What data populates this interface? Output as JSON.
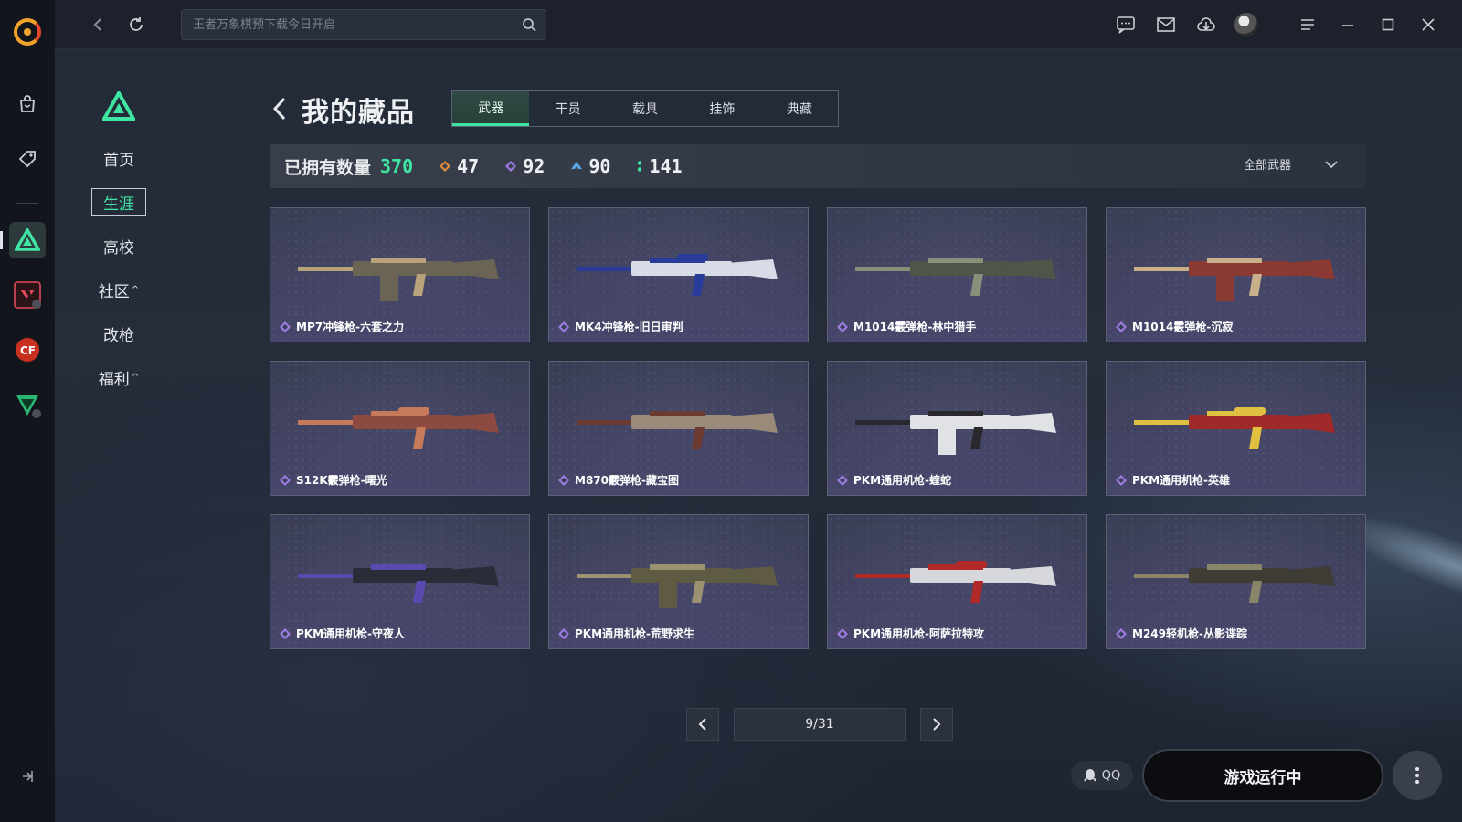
{
  "topbar": {
    "search_placeholder": "王者万象棋预下载今日开启"
  },
  "sidenav": {
    "items": [
      {
        "label": "首页",
        "caret": ""
      },
      {
        "label": "生涯",
        "caret": ""
      },
      {
        "label": "高校",
        "caret": ""
      },
      {
        "label": "社区",
        "caret": "^"
      },
      {
        "label": "改枪",
        "caret": ""
      },
      {
        "label": "福利",
        "caret": "^"
      }
    ],
    "active_index": 1
  },
  "header": {
    "title": "我的藏品",
    "tabs": [
      "武器",
      "干员",
      "载具",
      "挂饰",
      "典藏"
    ],
    "active_tab": 0
  },
  "stats": {
    "owned_label": "已拥有数量",
    "owned_count": "370",
    "rarities": [
      {
        "icon": "orange-diamond-icon",
        "color": "#e08a3c",
        "count": "47"
      },
      {
        "icon": "purple-diamond-icon",
        "color": "#9b7be0",
        "count": "92"
      },
      {
        "icon": "blue-arrow-icon",
        "color": "#5aa6e8",
        "count": "90"
      },
      {
        "icon": "green-dots-icon",
        "color": "#3fe6a3",
        "count": "141"
      }
    ],
    "filter_label": "全部武器"
  },
  "items": [
    {
      "name": "MP7冲锋枪-六套之力",
      "body": "#6b6455",
      "accent": "#b8a27a"
    },
    {
      "name": "MK4冲锋枪-旧日审判",
      "body": "#d8dce6",
      "accent": "#2a3c9a"
    },
    {
      "name": "M1014霰弹枪-林中猎手",
      "body": "#4d5648",
      "accent": "#8a8f7a"
    },
    {
      "name": "M1014霰弹枪-沉寂",
      "body": "#8a3a32",
      "accent": "#c8b08a"
    },
    {
      "name": "S12K霰弹枪-曙光",
      "body": "#8c4a40",
      "accent": "#c67a5a"
    },
    {
      "name": "M870霰弹枪-藏宝图",
      "body": "#9a8a7a",
      "accent": "#6b3a30"
    },
    {
      "name": "PKM通用机枪-蝰蛇",
      "body": "#e0e2e6",
      "accent": "#2a2a2e"
    },
    {
      "name": "PKM通用机枪-英雄",
      "body": "#a02a2a",
      "accent": "#e0c040"
    },
    {
      "name": "PKM通用机枪-守夜人",
      "body": "#2a2c38",
      "accent": "#5a4ab0"
    },
    {
      "name": "PKM通用机枪-荒野求生",
      "body": "#5e5a44",
      "accent": "#9a9270"
    },
    {
      "name": "PKM通用机枪-阿萨拉特攻",
      "body": "#d6d8dc",
      "accent": "#b02a2a"
    },
    {
      "name": "M249轻机枪-丛影谍踪",
      "body": "#3e3c34",
      "accent": "#8a8468"
    }
  ],
  "pagination": {
    "text": "9/31"
  },
  "footer": {
    "qq_label": "QQ",
    "launch_label": "游戏运行中"
  },
  "colors": {
    "accent": "#3fe6a3",
    "rail_bg": "#12151b"
  }
}
